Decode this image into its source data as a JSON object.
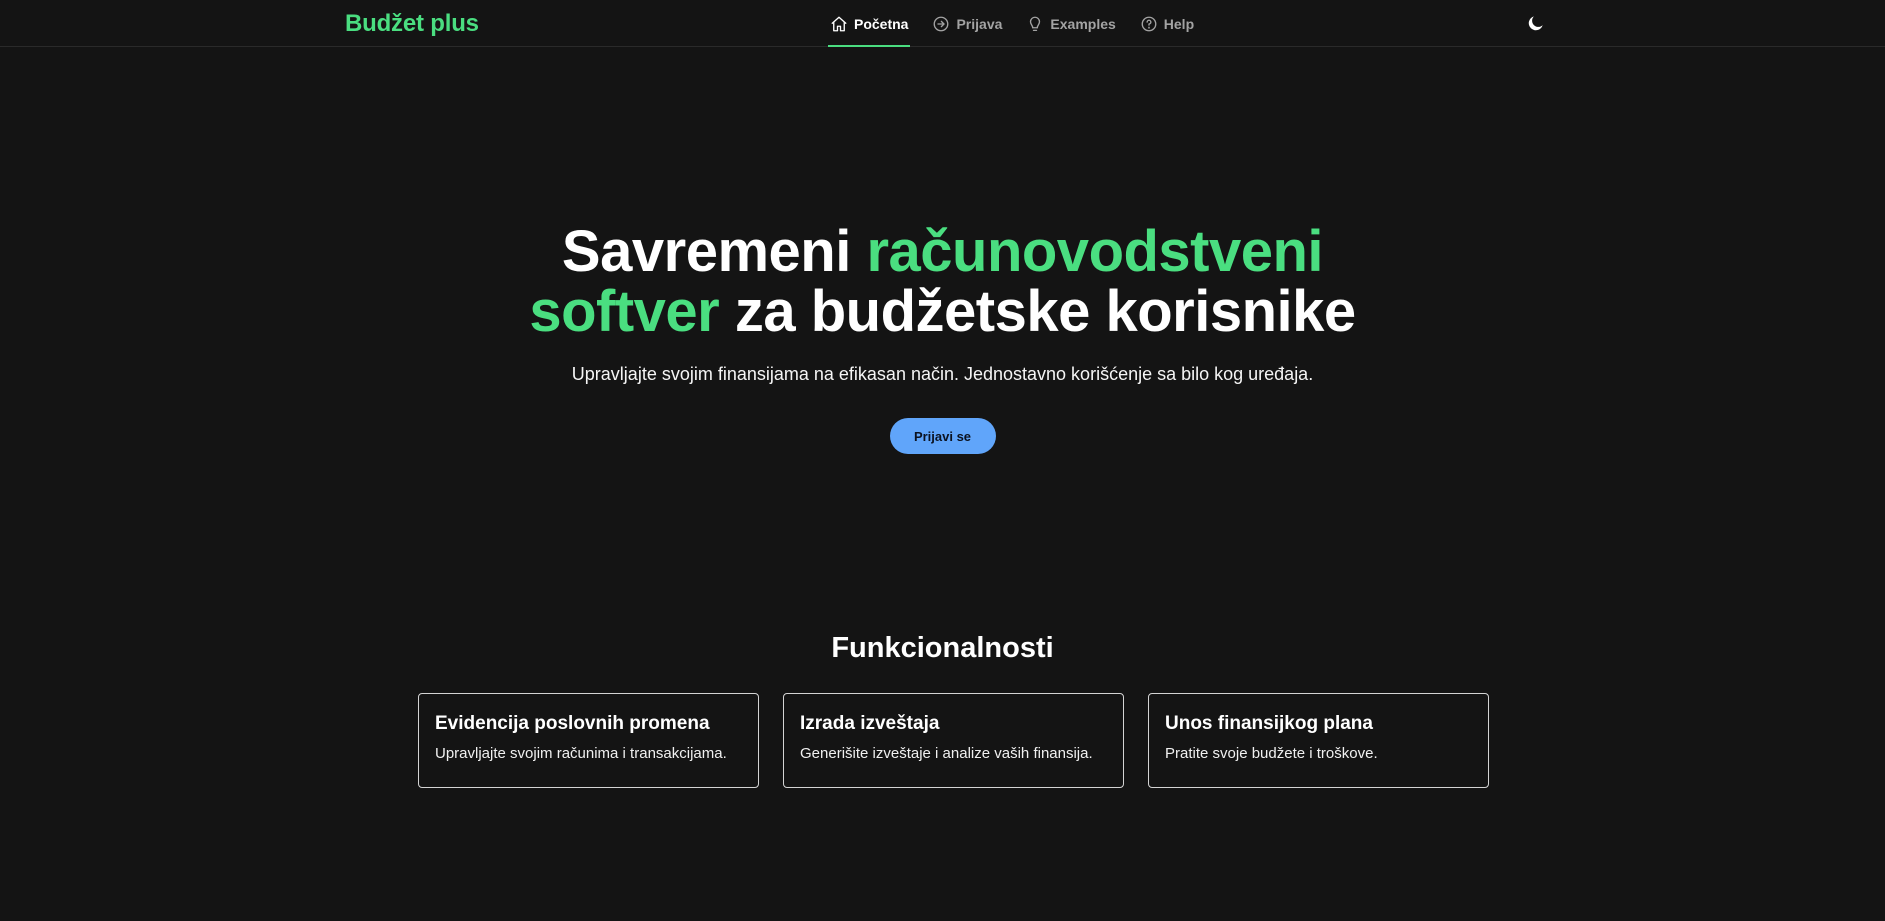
{
  "header": {
    "brand": "Budžet plus",
    "nav": [
      {
        "label": "Početna",
        "icon": "home-icon",
        "active": true
      },
      {
        "label": "Prijava",
        "icon": "arrow-right-circle-icon",
        "active": false
      },
      {
        "label": "Examples",
        "icon": "lightbulb-icon",
        "active": false
      },
      {
        "label": "Help",
        "icon": "help-circle-icon",
        "active": false
      }
    ],
    "theme_toggle_icon": "moon-icon"
  },
  "hero": {
    "title_part1": "Savremeni ",
    "title_accent1": "računovodstveni",
    "title_accent2": "softver",
    "title_part2": " za budžetske korisnike",
    "subtitle": "Upravljajte svojim finansijama na efikasan način. Jednostavno korišćenje sa bilo kog uređaja.",
    "cta_label": "Prijavi se"
  },
  "features": {
    "title": "Funkcionalnosti",
    "cards": [
      {
        "title": "Evidencija poslovnih promena",
        "description": "Upravljajte svojim računima i transakcijama."
      },
      {
        "title": "Izrada izveštaja",
        "description": "Generišite izveštaje i analize vaših finansija."
      },
      {
        "title": "Unos finansijkog plana",
        "description": "Pratite svoje budžete i troškove."
      }
    ]
  },
  "colors": {
    "background": "#141414",
    "accent_green": "#4ade80",
    "button_blue": "#60a5fa",
    "card_border": "#d4d4d4"
  }
}
